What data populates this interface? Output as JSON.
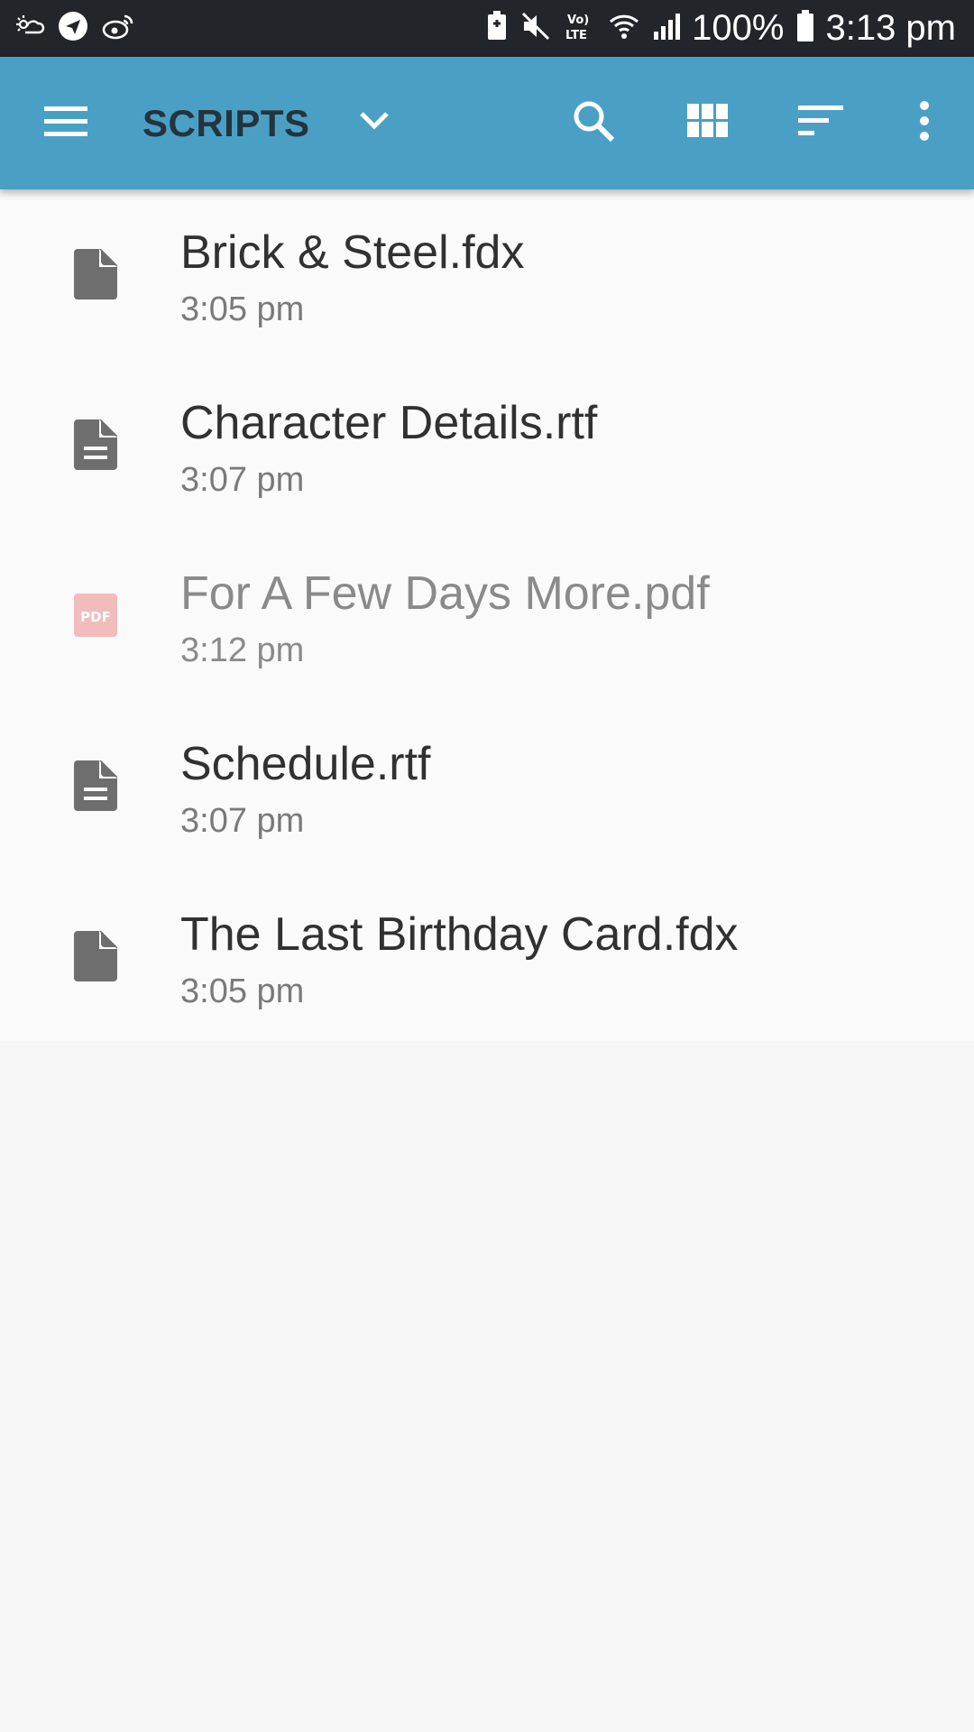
{
  "status_bar": {
    "battery_percent": "100%",
    "time": "3:13 pm"
  },
  "app_bar": {
    "title": "SCRIPTS"
  },
  "files": [
    {
      "name": "Brick & Steel.fdx",
      "time": "3:05 pm",
      "icon": "file-icon"
    },
    {
      "name": "Character Details.rtf",
      "time": "3:07 pm",
      "icon": "document-icon"
    },
    {
      "name": "For A Few Days More.pdf",
      "time": "3:12 pm",
      "icon": "pdf-icon",
      "pdf_label": "PDF"
    },
    {
      "name": "Schedule.rtf",
      "time": "3:07 pm",
      "icon": "document-icon"
    },
    {
      "name": "The Last Birthday Card.fdx",
      "time": "3:05 pm",
      "icon": "file-icon"
    }
  ],
  "colors": {
    "status_bar": "#222529",
    "app_bar": "#4aa0c4",
    "title": "#24343e",
    "pdf_accent": "#f0bcbc"
  }
}
